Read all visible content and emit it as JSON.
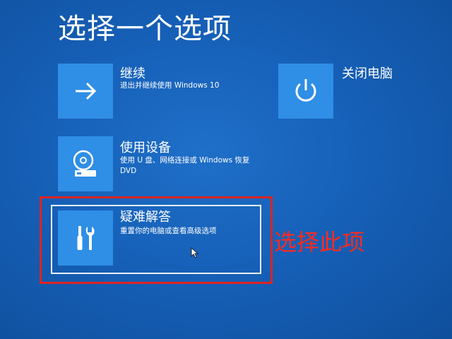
{
  "page": {
    "title": "选择一个选项"
  },
  "options": {
    "continue": {
      "title": "继续",
      "description": "退出并继续使用 Windows 10",
      "icon": "arrow-right-icon"
    },
    "shutdown": {
      "title": "关闭电脑",
      "icon": "power-icon"
    },
    "use_device": {
      "title": "使用设备",
      "description_line1": "使用 U 盘、网络连接或 Windows 恢复",
      "description_line2": "DVD",
      "icon": "disc-drive-icon"
    },
    "troubleshoot": {
      "title": "疑难解答",
      "description": "重置你的电脑或查看高级选项",
      "icon": "tools-icon"
    }
  },
  "annotation": {
    "text": "选择此项",
    "color": "#e0231f"
  },
  "colors": {
    "background": "#1a63b8",
    "tile_icon_bg": "#2f8ee6",
    "highlight_outline": "#e9eef7"
  }
}
